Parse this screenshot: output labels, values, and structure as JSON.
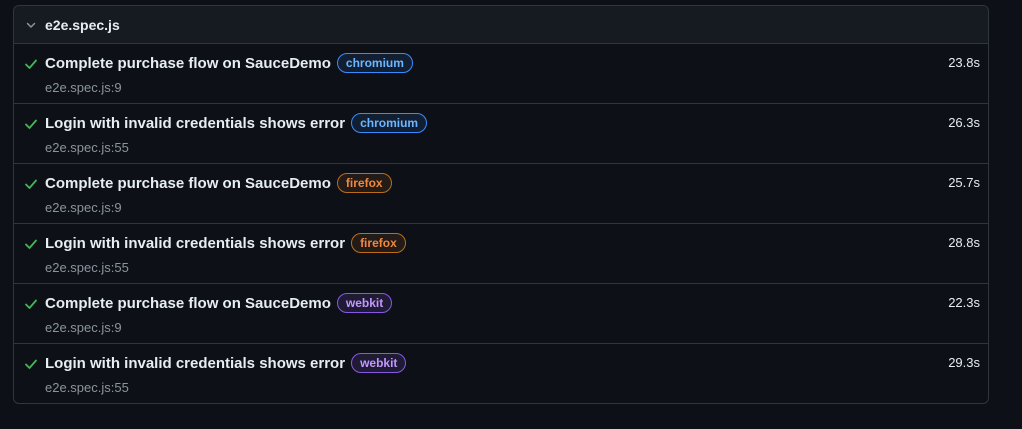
{
  "file": {
    "name": "e2e.spec.js",
    "expanded": true
  },
  "colors": {
    "pass": "#3fb950",
    "chromium": "#388bfd",
    "firefox": "#bb6d1a",
    "webkit": "#8957e5"
  },
  "tests": [
    {
      "title": "Complete purchase flow on SauceDemo",
      "browser": "chromium",
      "location": "e2e.spec.js:9",
      "duration": "23.8s",
      "status": "passed",
      "status_icon": "check-icon"
    },
    {
      "title": "Login with invalid credentials shows error",
      "browser": "chromium",
      "location": "e2e.spec.js:55",
      "duration": "26.3s",
      "status": "passed",
      "status_icon": "check-icon"
    },
    {
      "title": "Complete purchase flow on SauceDemo",
      "browser": "firefox",
      "location": "e2e.spec.js:9",
      "duration": "25.7s",
      "status": "passed",
      "status_icon": "check-icon"
    },
    {
      "title": "Login with invalid credentials shows error",
      "browser": "firefox",
      "location": "e2e.spec.js:55",
      "duration": "28.8s",
      "status": "passed",
      "status_icon": "check-icon"
    },
    {
      "title": "Complete purchase flow on SauceDemo",
      "browser": "webkit",
      "location": "e2e.spec.js:9",
      "duration": "22.3s",
      "status": "passed",
      "status_icon": "check-icon"
    },
    {
      "title": "Login with invalid credentials shows error",
      "browser": "webkit",
      "location": "e2e.spec.js:55",
      "duration": "29.3s",
      "status": "passed",
      "status_icon": "check-icon"
    }
  ]
}
